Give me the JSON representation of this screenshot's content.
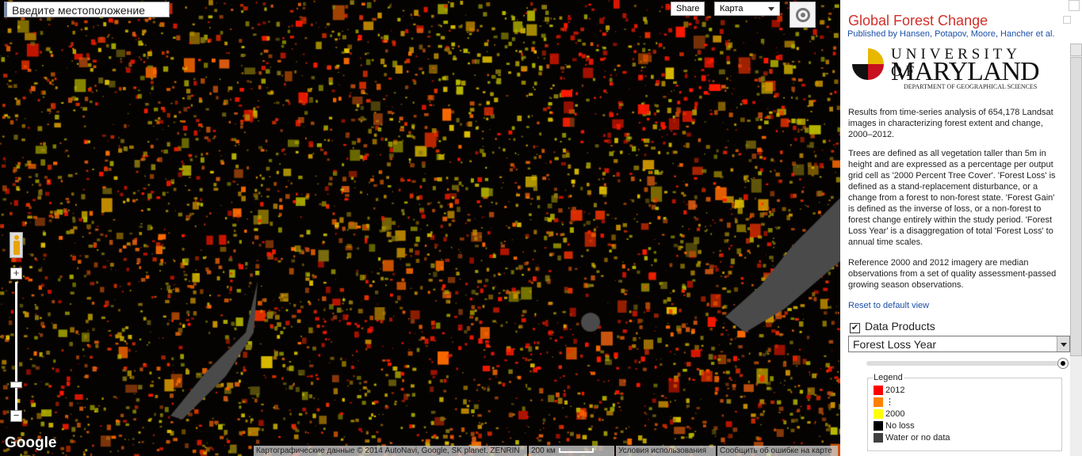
{
  "map": {
    "search_placeholder": "Введите местоположение",
    "share_label": "Share",
    "map_type": "Карта",
    "zoom_in": "+",
    "zoom_out": "−",
    "google_logo": "Google",
    "attribution": "Картографические данные © 2014 AutoNavi, Google, SK planet, ZENRIN",
    "scale": "200 км",
    "terms": "Условия использования",
    "report": "Сообщить об ошибке на карте"
  },
  "panel": {
    "title": "Global Forest Change",
    "published": "Published by Hansen, Potapov, Moore, Hancher et al.",
    "logo": {
      "line1": "UNIVERSITY OF",
      "line2": "MARYLAND",
      "line3": "DEPARTMENT OF GEOGRAPHICAL SCIENCES"
    },
    "para1": "Results from time-series analysis of 654,178 Landsat images in characterizing forest extent and change, 2000–2012.",
    "para2": "Trees are defined as all vegetation taller than 5m in height and are expressed as a percentage per output grid cell as '2000 Percent Tree Cover'. 'Forest Loss' is defined as a stand-replacement disturbance, or a change from a forest to non-forest state. 'Forest Gain' is defined as the inverse of loss, or a non-forest to forest change entirely within the study period. 'Forest Loss Year' is a disaggregation of total 'Forest Loss' to annual time scales.",
    "para3": "Reference 2000 and 2012 imagery are median observations from a set of quality assessment-passed growing season observations.",
    "reset": "Reset to default view",
    "data_products": "Data Products",
    "data_products_checked": true,
    "product": "Forest Loss Year",
    "opacity": 1.0,
    "legend_title": "Legend",
    "legend": [
      {
        "label": "2012",
        "color": "#ff0000"
      },
      {
        "label": "⋮",
        "color": "#ff8000"
      },
      {
        "label": "2000",
        "color": "#ffff00"
      },
      {
        "label": "No loss",
        "color": "#000000"
      },
      {
        "label": "Water or no data",
        "color": "#404040"
      }
    ]
  }
}
